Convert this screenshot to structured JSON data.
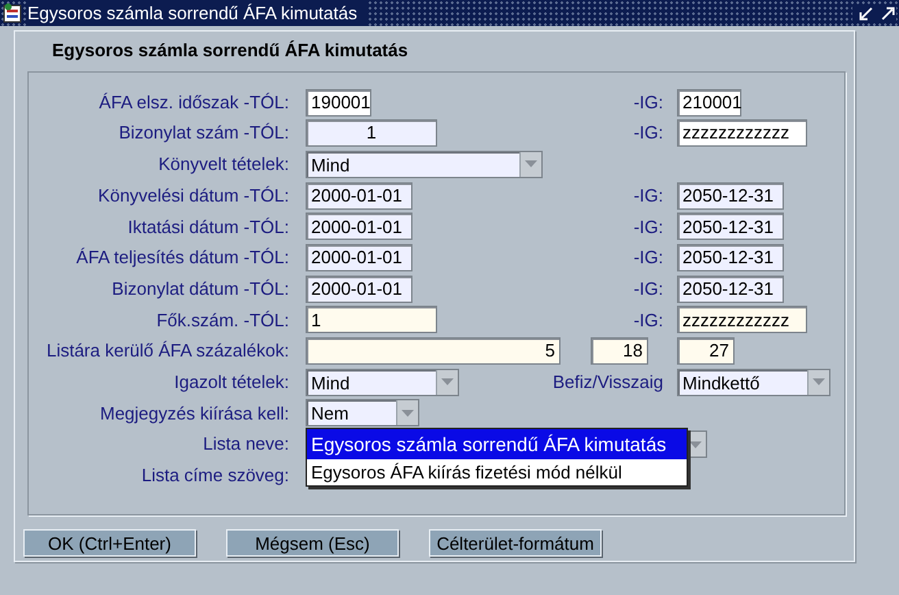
{
  "window": {
    "title": "Egysoros számla sorrendű ÁFA kimutatás"
  },
  "form": {
    "heading": "Egysoros számla sorrendű ÁFA kimutatás",
    "rows": [
      {
        "label": "ÁFA elsz. időszak -TÓL:",
        "left": [
          {
            "kind": "text",
            "value": "190001",
            "color": "#ffffff"
          }
        ],
        "right_label": "-IG:",
        "right": [
          {
            "kind": "text",
            "value": "210001",
            "color": "#ffffff"
          }
        ]
      },
      {
        "label": "Bizonylat szám -TÓL:",
        "left": [
          {
            "kind": "text",
            "value": "1",
            "color": "#eef0ff"
          }
        ],
        "right_label": "-IG:",
        "right": [
          {
            "kind": "text",
            "value": "zzzzzzzzzzzz",
            "color": "#ffffff"
          }
        ]
      },
      {
        "label": "Könyvelt tételek:",
        "left": [
          {
            "kind": "select",
            "value": "Mind",
            "color": "#eef0ff"
          }
        ]
      },
      {
        "label": "Könyvelési dátum -TÓL:",
        "left": [
          {
            "kind": "text",
            "value": "2000-01-01",
            "color": "#eef0ff"
          }
        ],
        "right_label": "-IG:",
        "right": [
          {
            "kind": "text",
            "value": "2050-12-31",
            "color": "#eef0ff"
          }
        ]
      },
      {
        "label": "Iktatási dátum -TÓL:",
        "left": [
          {
            "kind": "text",
            "value": "2000-01-01",
            "color": "#eef0ff"
          }
        ],
        "right_label": "-IG:",
        "right": [
          {
            "kind": "text",
            "value": "2050-12-31",
            "color": "#eef0ff"
          }
        ]
      },
      {
        "label": "ÁFA teljesítés dátum -TÓL:",
        "left": [
          {
            "kind": "text",
            "value": "2000-01-01",
            "color": "#eef0ff"
          }
        ],
        "right_label": "-IG:",
        "right": [
          {
            "kind": "text",
            "value": "2050-12-31",
            "color": "#eef0ff"
          }
        ]
      },
      {
        "label": "Bizonylat dátum -TÓL:",
        "left": [
          {
            "kind": "text",
            "value": "2000-01-01",
            "color": "#eef0ff"
          }
        ],
        "right_label": "-IG:",
        "right": [
          {
            "kind": "text",
            "value": "2050-12-31",
            "color": "#eef0ff"
          }
        ]
      },
      {
        "label": "Fők.szám. -TÓL:",
        "left": [
          {
            "kind": "text",
            "value": "1",
            "color": "#fffbee"
          }
        ],
        "right_label": "-IG:",
        "right": [
          {
            "kind": "text",
            "value": "zzzzzzzzzzzz",
            "color": "#fffbee"
          }
        ]
      },
      {
        "label": "Listára kerülő ÁFA százalékok:",
        "left": [
          {
            "kind": "text",
            "value": "5",
            "color": "#fffbee"
          },
          {
            "kind": "text",
            "value": "18",
            "color": "#fffbee"
          }
        ],
        "right": [
          {
            "kind": "text",
            "value": "27",
            "color": "#fffbee"
          }
        ]
      },
      {
        "label": "Igazolt tételek:",
        "left": [
          {
            "kind": "select",
            "value": "Mind",
            "color": "#eef0ff"
          }
        ],
        "right_label": "Befiz/Visszaig",
        "right": [
          {
            "kind": "select",
            "value": "Mindkettő",
            "color": "#eef0ff"
          }
        ]
      },
      {
        "label": "Megjegyzés kiírása kell:",
        "left": [
          {
            "kind": "select",
            "value": "Nem",
            "color": "#eef0ff"
          }
        ]
      },
      {
        "label": "Lista neve:",
        "left": [
          {
            "kind": "select",
            "expanded": true,
            "options": [
              {
                "label": "Egysoros számla sorrendű ÁFA kimutatás",
                "selected": true
              },
              {
                "label": "Egysoros ÁFA kiírás fizetési mód nélkül",
                "selected": false
              }
            ]
          }
        ]
      },
      {
        "label": "Lista címe szöveg:",
        "left": []
      }
    ]
  },
  "buttons": [
    "OK (Ctrl+Enter)",
    "Mégsem (Esc)",
    "Célterület-formátum"
  ]
}
